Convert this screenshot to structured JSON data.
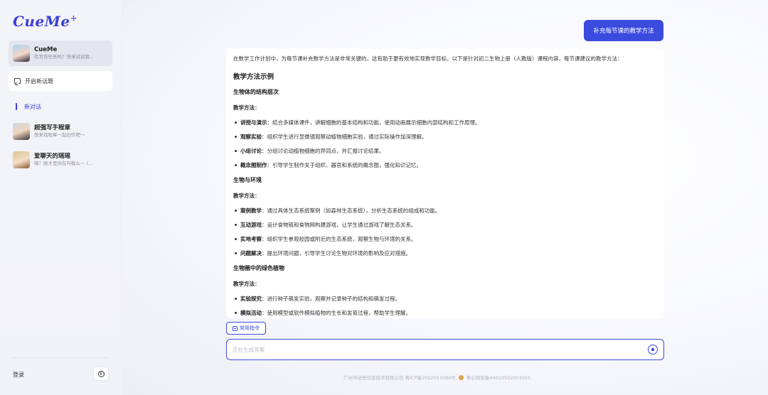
{
  "sidebar": {
    "logo_text": "CueMe",
    "logo_star": "+",
    "agent": {
      "name": "CueMe",
      "subtitle": "有写作任务吗？快来试试我..."
    },
    "new_topic_label": "开启新话题",
    "active_conversation": "新对话",
    "history": [
      {
        "title": "超强写手程章",
        "subtitle": "快来找程章一起创作吧～"
      },
      {
        "title": "爱聊天的瑶瑶",
        "subtitle": "嗨？刚才是你在叫我么～ (..."
      }
    ],
    "login_label": "登录",
    "info_icon_glyph": "i"
  },
  "chat": {
    "user_message": "补充每节课的教学方法",
    "answer": {
      "intro": "在数学工作计划中，为每节课补充数学方法是非常关键的，这有助于更有效地实现数学目标。以下是针对初二生物上册（人教版）课程内容，每节课建议的教学方法：",
      "heading": "教学方法示例",
      "sections": [
        {
          "title": "生物体的结构层次",
          "label": "教学方法：",
          "bullets": [
            {
              "term": "讲授与演示",
              "text": "：结合多媒体课件，讲解细胞的基本结构和功能，使用动画展示细胞内部结构和工作原理。"
            },
            {
              "term": "观察实验",
              "text": "：组织学生进行显微镜观察动植物细胞实验，通过实际操作加深理解。"
            },
            {
              "term": "小组讨论",
              "text": "：分组讨论动植物细胞的异同点，并汇报讨论结果。"
            },
            {
              "term": "概念图制作",
              "text": "：引导学生制作关于组织、器官和系统的概念图，强化知识记忆。"
            }
          ]
        },
        {
          "title": "生物与环境",
          "label": "教学方法：",
          "bullets": [
            {
              "term": "案例教学",
              "text": "：通过具体生态系统案例（如森林生态系统），分析生态系统的组成和功能。"
            },
            {
              "term": "互动游戏",
              "text": "：设计食物链和食物网构建游戏，让学生通过游戏了解生态关系。"
            },
            {
              "term": "实地考察",
              "text": "：组织学生参观校园或附近的生态系统，观察生物与环境的关系。"
            },
            {
              "term": "问题解决",
              "text": "：提出环境问题，引导学生讨论生物对环境的影响及应对措施。"
            }
          ]
        },
        {
          "title": "生物圈中的绿色植物",
          "label": "教学方法：",
          "bullets": [
            {
              "term": "实验探究",
              "text": "：进行种子萌发实验，观察并记录种子的结构和萌发过程。"
            },
            {
              "term": "模拟活动",
              "text": "：使用模型或软件模拟植物的生长和发育过程，帮助学生理解。"
            }
          ]
        }
      ]
    },
    "commands_label": "常用指令",
    "input_placeholder": "正在生成答案",
    "footer_company": "广州市动悦信息技术有限公司 粤ICP备2022013084号",
    "footer_police": "粤公网安备44010502003055"
  },
  "colors": {
    "accent": "#3b4be0",
    "brand_logo": "#3b3fd8",
    "sidebar_bg": "#f3f4f8"
  }
}
